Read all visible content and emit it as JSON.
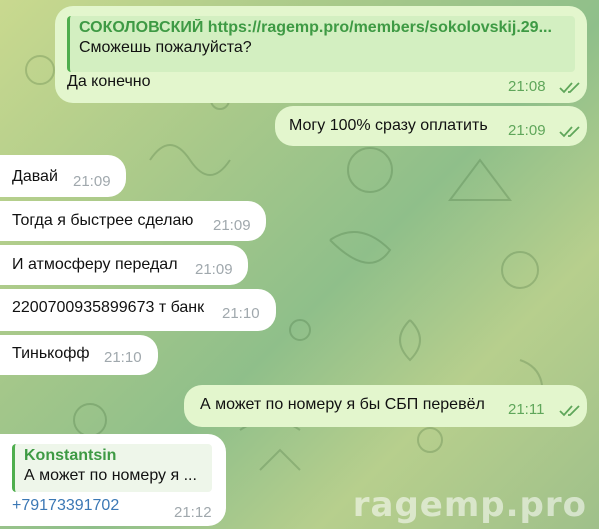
{
  "messages": [
    {
      "direction": "out",
      "reply": {
        "author": "СОКОЛОВСКИЙ https://ragemp.pro/members/sokolovskij.29...",
        "text": "Сможешь пожалуйста?"
      },
      "text": "Да конечно",
      "time": "21:08",
      "status": "read"
    },
    {
      "direction": "out",
      "text": "Могу 100% сразу оплатить",
      "time": "21:09",
      "status": "read"
    },
    {
      "direction": "in",
      "text": "Давай",
      "time": "21:09"
    },
    {
      "direction": "in",
      "text": "Тогда я быстрее сделаю",
      "time": "21:09"
    },
    {
      "direction": "in",
      "text": "И атмосферу передал",
      "time": "21:09"
    },
    {
      "direction": "in",
      "text": "2200700935899673 т банк",
      "time": "21:10"
    },
    {
      "direction": "in",
      "text": "Тинькофф",
      "time": "21:10"
    },
    {
      "direction": "out",
      "text": "А может по номеру я бы СБП перевёл",
      "time": "21:11",
      "status": "read"
    },
    {
      "direction": "in",
      "reply": {
        "author": "Konstantsin",
        "text": "А может по номеру я ..."
      },
      "text": "+79173391702",
      "time": "21:12"
    }
  ],
  "watermark": "ragemp.pro",
  "colors": {
    "outgoing_bubble": "#e3f6cd",
    "incoming_bubble": "#ffffff",
    "accent_green": "#4fae4e",
    "link": "#3b78b5"
  }
}
